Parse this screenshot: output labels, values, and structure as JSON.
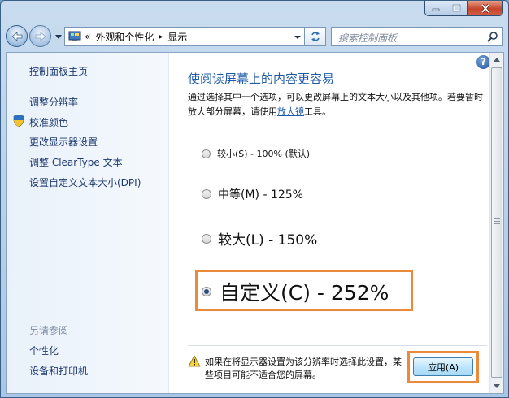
{
  "window": {
    "caption_buttons": [
      "minimize",
      "maximize",
      "close"
    ]
  },
  "navigation": {
    "back_icon": "back-arrow-icon",
    "forward_icon": "forward-arrow-icon",
    "address": {
      "overflow": "«",
      "crumbs": [
        "外观和个性化",
        "显示"
      ],
      "separator": "▸"
    },
    "search_placeholder": "搜索控制面板"
  },
  "sidebar": {
    "home": "控制面板主页",
    "links": [
      "调整分辨率",
      "校准颜色",
      "更改显示器设置",
      "调整 ClearType 文本",
      "设置自定义文本大小(DPI)"
    ],
    "see_also_title": "另请参阅",
    "see_also": [
      "个性化",
      "设备和打印机"
    ]
  },
  "main": {
    "help_label": "?",
    "heading": "使阅读屏幕上的内容更容易",
    "description_before": "通过选择其中一个选项，可以更改屏幕上的文本大小以及其他项。若要暂时放大部分屏幕，请使用",
    "description_link": "放大镜",
    "description_after": "工具。",
    "options": [
      {
        "label": "较小(S) - 100% (默认)",
        "selected": false
      },
      {
        "label": "中等(M) - 125%",
        "selected": false
      },
      {
        "label": "较大(L) - 150%",
        "selected": false
      },
      {
        "label": "自定义(C) - 252%",
        "selected": true
      }
    ],
    "warning": "如果在将显示器设置为该分辨率时选择此设置，某些项目可能不适合您的屏幕。",
    "apply_label": "应用(A)"
  },
  "colors": {
    "highlight": "#ec8a3b",
    "heading": "#1e5aa8",
    "link": "#1e3a6e"
  }
}
